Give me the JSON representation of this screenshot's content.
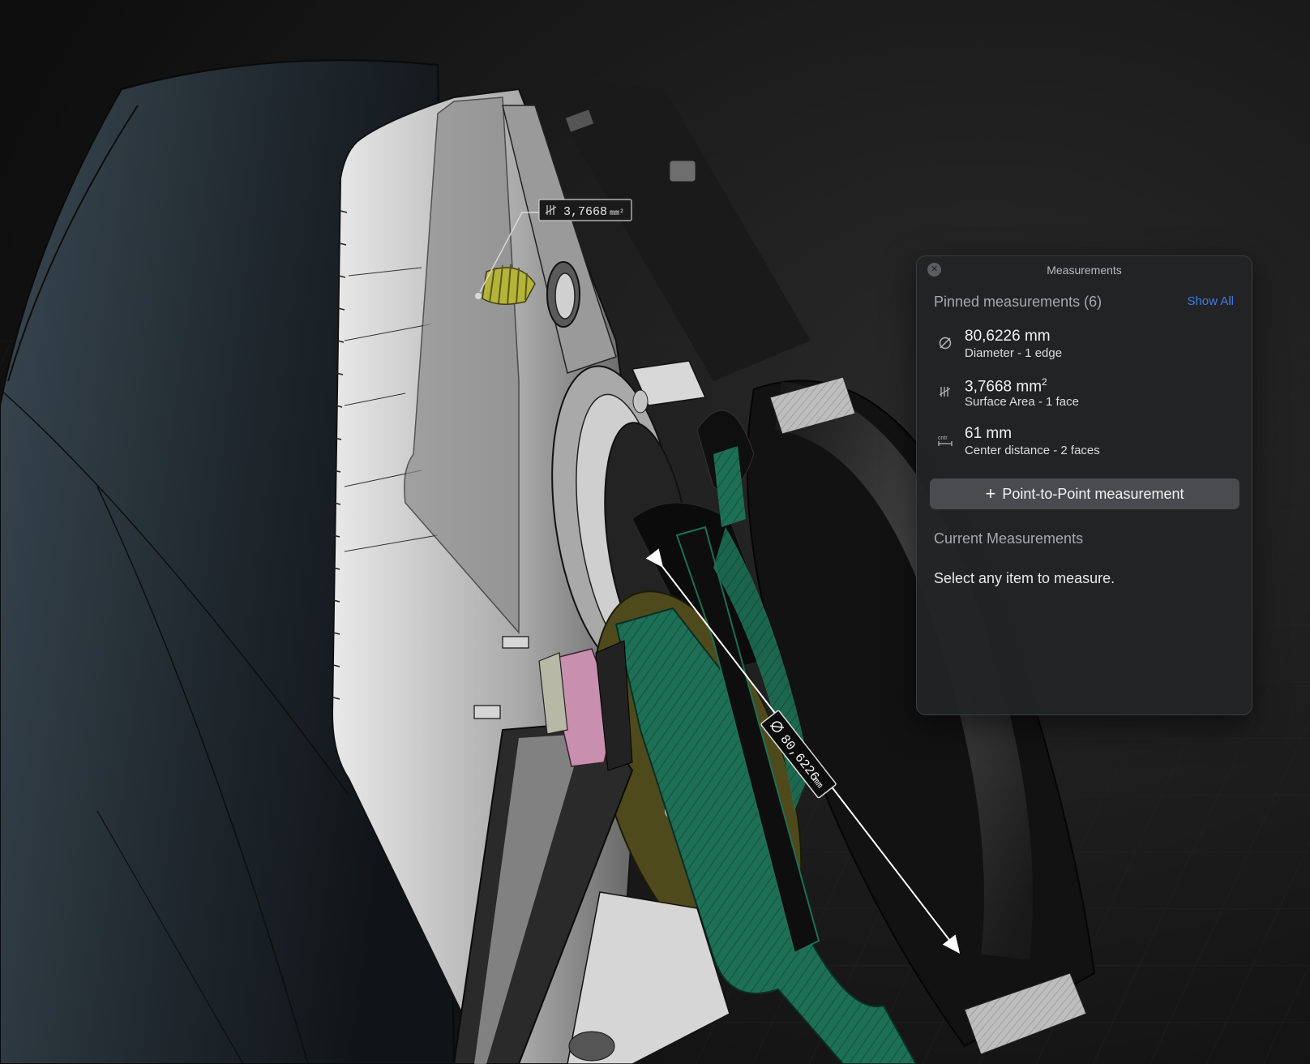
{
  "viewport": {
    "callout_area": "3,7668",
    "callout_area_unit": "mm²",
    "dimension_label": "80,6226",
    "dimension_unit": "mm",
    "colors": {
      "section_green": "#1d6f55",
      "spring_yellow": "#b5b43a",
      "pad_pink": "#c88fae",
      "olive_disc": "#4f4a1c"
    }
  },
  "panel": {
    "title": "Measurements",
    "close_icon": "close-x",
    "pinned_title": "Pinned measurements (6)",
    "show_all": "Show All",
    "items": [
      {
        "icon": "diameter-icon",
        "value": "80,6226 mm",
        "subtitle": "Diameter - 1 edge"
      },
      {
        "icon": "surface-area-icon",
        "value": "3,7668 mm",
        "value_sup": "2",
        "subtitle": "Surface Area - 1 face"
      },
      {
        "icon": "center-distance-icon",
        "value": "61 mm",
        "subtitle": "Center distance - 2 faces"
      }
    ],
    "add_button": "Point-to-Point measurement",
    "current_title": "Current Measurements",
    "hint": "Select any item to measure.",
    "accent": "#3f7be8"
  }
}
